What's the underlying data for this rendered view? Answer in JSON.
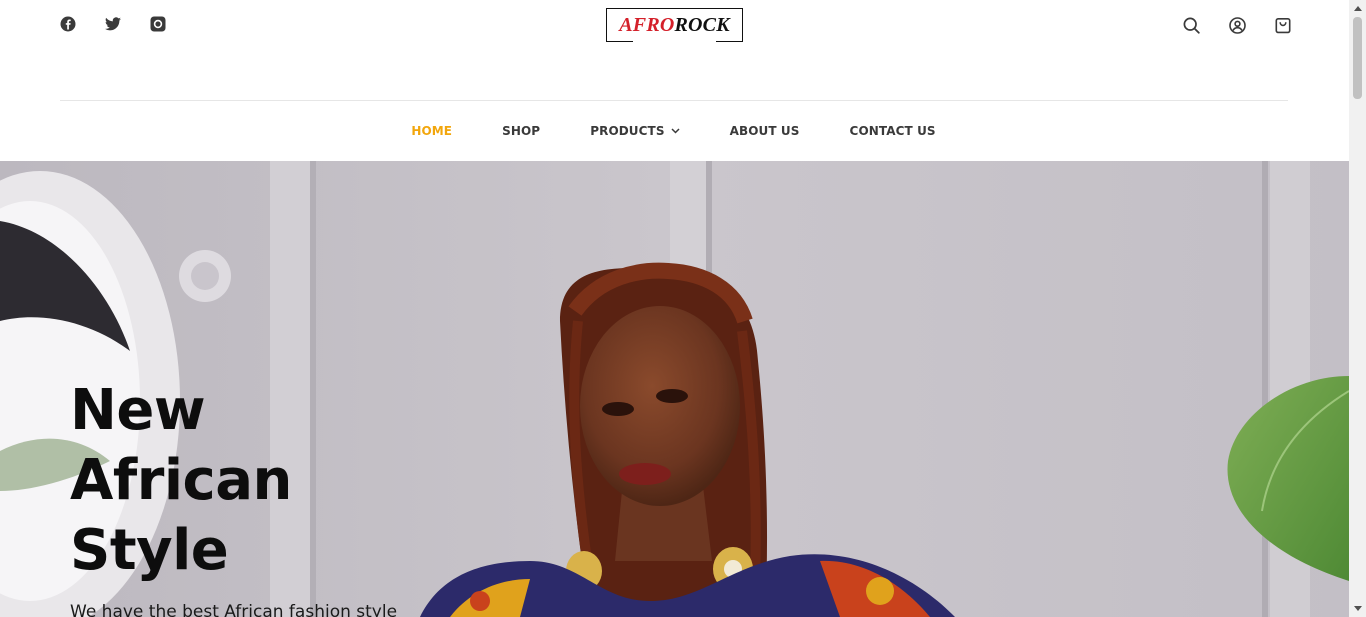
{
  "social": {
    "icons": [
      "facebook-icon",
      "twitter-icon",
      "instagram-icon"
    ]
  },
  "logo": {
    "part1": "AFRO",
    "part2": "ROCK",
    "part1_color": "#d4202a",
    "part2_color": "#111111"
  },
  "header_actions": {
    "icons": [
      "search-icon",
      "account-icon",
      "cart-icon"
    ]
  },
  "nav": {
    "items": [
      {
        "label": "HOME",
        "active": true
      },
      {
        "label": "SHOP",
        "active": false
      },
      {
        "label": "PRODUCTS",
        "active": false,
        "has_dropdown": true
      },
      {
        "label": "ABOUT US",
        "active": false
      },
      {
        "label": "CONTACT US",
        "active": false
      }
    ],
    "active_color": "#f2a60c"
  },
  "hero": {
    "title_line1": "New",
    "title_line2": "African",
    "title_line3": "Style",
    "subtitle": "We have the best African fashion style"
  }
}
